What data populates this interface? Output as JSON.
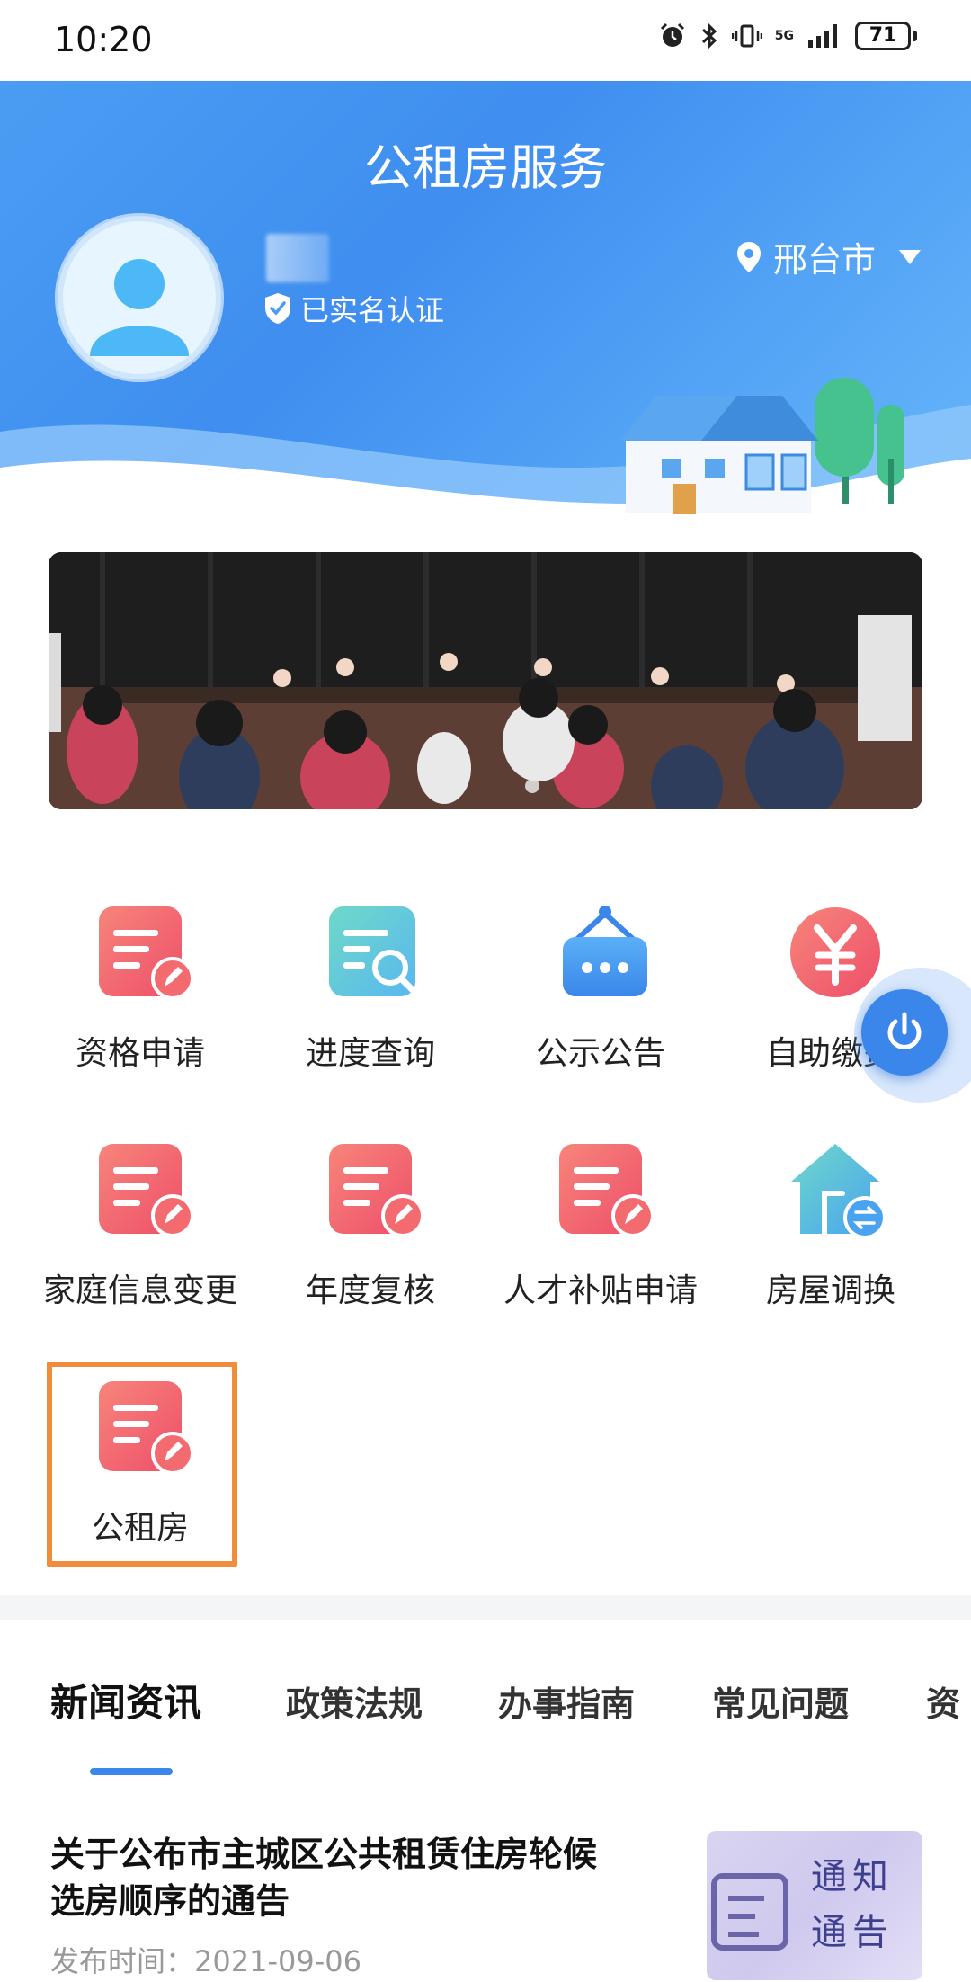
{
  "status_bar": {
    "time": "10:20",
    "battery": "71",
    "network": "5G"
  },
  "header": {
    "title": "公租房服务",
    "verified_label": "已实名认证",
    "city": "邢台市"
  },
  "grid": {
    "items": [
      {
        "label": "资格申请",
        "icon": "form-edit-icon"
      },
      {
        "label": "进度查询",
        "icon": "search-list-icon"
      },
      {
        "label": "公示公告",
        "icon": "notice-board-icon"
      },
      {
        "label": "自助缴费",
        "icon": "yuan-icon"
      },
      {
        "label": "家庭信息变更",
        "icon": "form-edit-icon"
      },
      {
        "label": "年度复核",
        "icon": "form-edit-icon"
      },
      {
        "label": "人才补贴申请",
        "icon": "form-edit-icon"
      },
      {
        "label": "房屋调换",
        "icon": "house-swap-icon"
      },
      {
        "label": "公租房",
        "icon": "form-edit-icon"
      }
    ]
  },
  "tabs": [
    {
      "label": "新闻资讯",
      "active": true
    },
    {
      "label": "政策法规",
      "active": false
    },
    {
      "label": "办事指南",
      "active": false
    },
    {
      "label": "常见问题",
      "active": false
    },
    {
      "label": "资",
      "active": false
    }
  ],
  "news": {
    "title": "关于公布市主城区公共租赁住房轮候选房顺序的通告",
    "date": "发布时间：2021-09-06",
    "thumb_text": "通知通告"
  },
  "colors": {
    "brand_blue": "#3f8ef0",
    "icon_red": "#f0606a",
    "highlight_orange": "#f08c3c"
  }
}
